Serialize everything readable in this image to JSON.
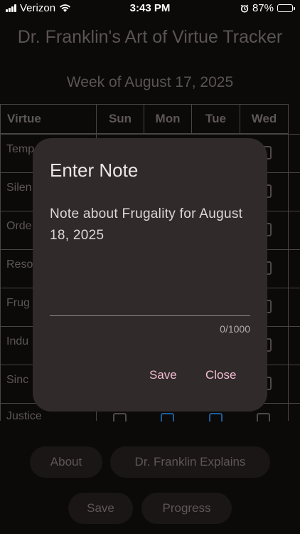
{
  "status_bar": {
    "carrier": "Verizon",
    "time": "3:43 PM",
    "battery": "87%",
    "battery_fraction": 0.87
  },
  "app": {
    "title": "Dr. Franklin's Art of Virtue Tracker",
    "week_label": "Week of August 17, 2025"
  },
  "table": {
    "headers": [
      "Virtue",
      "Sun",
      "Mon",
      "Tue",
      "Wed"
    ],
    "virtues": [
      "Temp",
      "Silen",
      "Orde",
      "Reso",
      "Frug",
      "Indu",
      "Sinc",
      "Justice"
    ]
  },
  "buttons": {
    "about": "About",
    "explains": "Dr. Franklin Explains",
    "save": "Save",
    "progress": "Progress"
  },
  "dialog": {
    "title": "Enter Note",
    "message": "Note about Frugality for August 18, 2025",
    "input_value": "",
    "counter": "0/1000",
    "save": "Save",
    "close": "Close"
  },
  "colors": {
    "accent": "#f1bcd3",
    "checkbox_checked": "#1d5d96"
  }
}
